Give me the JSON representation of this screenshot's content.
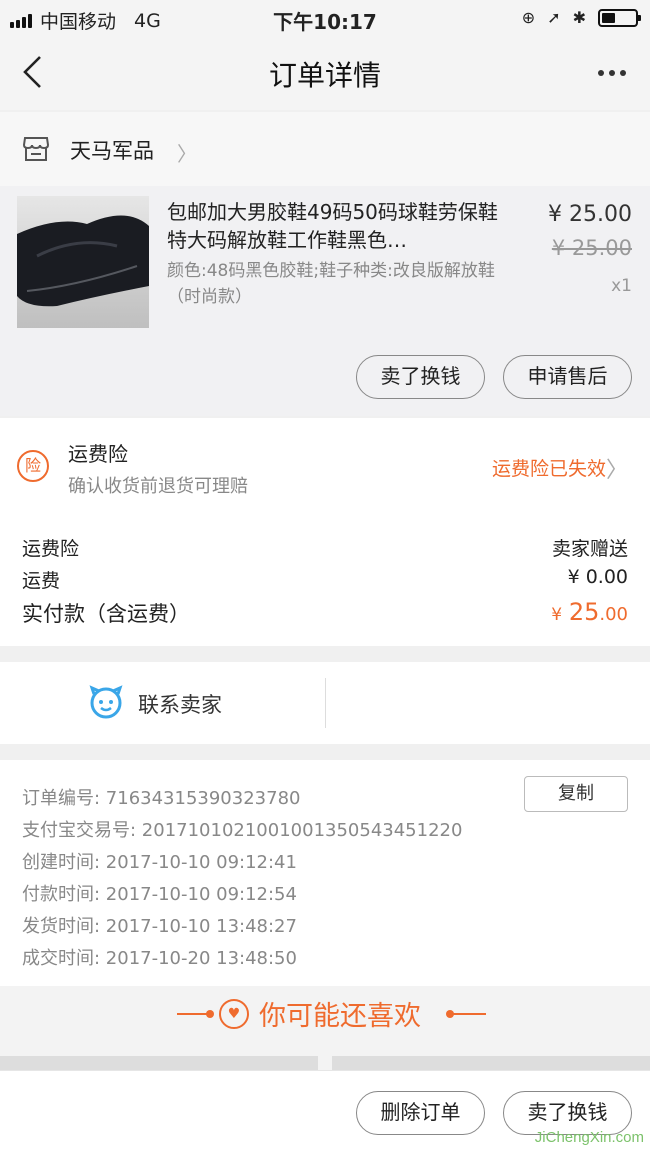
{
  "status_bar": {
    "carrier": "中国移动",
    "network": "4G",
    "time": "下午10:17"
  },
  "nav": {
    "title": "订单详情"
  },
  "shop": {
    "name": "天马军品"
  },
  "product": {
    "title": "包邮加大男胶鞋49码50码球鞋劳保鞋特大码解放鞋工作鞋黑色…",
    "attributes": "颜色:48码黑色胶鞋;鞋子种类:改良版解放鞋（时尚款）",
    "price": "¥ 25.00",
    "original_price": "¥ 25.00",
    "quantity": "x1",
    "sell_button": "卖了换钱",
    "aftersale_button": "申请售后"
  },
  "insurance": {
    "badge": "险",
    "title": "运费险",
    "subtitle": "确认收货前退货可理赔",
    "status": "运费险已失效"
  },
  "costs": {
    "insurance_label": "运费险",
    "insurance_value": "卖家赠送",
    "shipping_label": "运费",
    "shipping_value": "¥ 0.00",
    "paid_label": "实付款（含运费）",
    "paid_symbol": "¥",
    "paid_int": "25",
    "paid_dec": ".00"
  },
  "contact": {
    "label": "联系卖家"
  },
  "order_info": {
    "copy_button": "复制",
    "lines": [
      "订单编号:  71634315390323780",
      "支付宝交易号:  2017101021001001350543451220",
      "创建时间:  2017-10-10 09:12:41",
      "付款时间:  2017-10-10 09:12:54",
      "发货时间:  2017-10-10 13:48:27",
      "成交时间:  2017-10-20 13:48:50"
    ]
  },
  "recommend": {
    "title": "你可能还喜欢"
  },
  "bottom_bar": {
    "delete_button": "删除订单",
    "sell_button": "卖了换钱"
  },
  "watermark": "JiChengXin.com",
  "colors": {
    "accent": "#ef6b2e",
    "contact_icon": "#3aa6e8"
  }
}
